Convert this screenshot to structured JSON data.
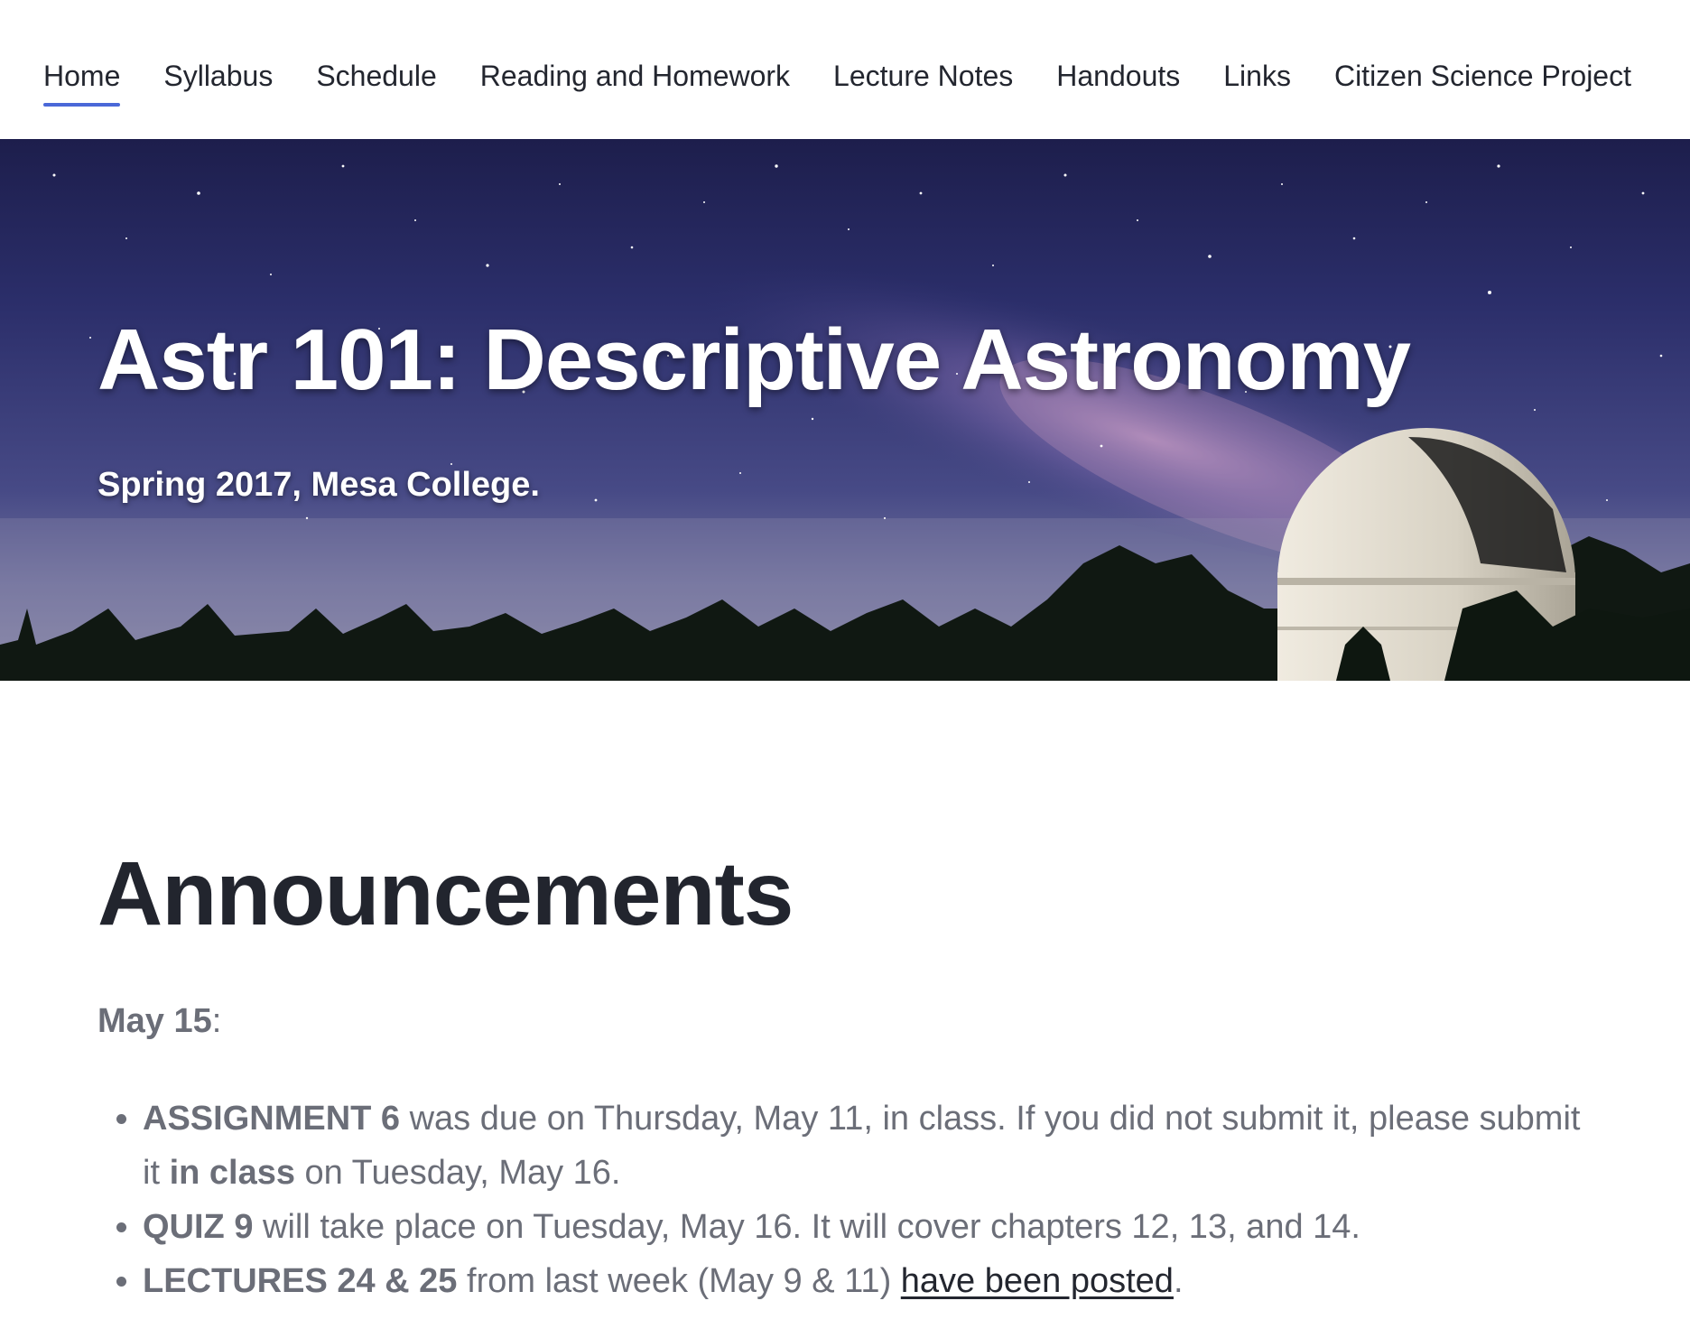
{
  "nav": {
    "items": [
      {
        "label": "Home",
        "active": true
      },
      {
        "label": "Syllabus",
        "active": false
      },
      {
        "label": "Schedule",
        "active": false
      },
      {
        "label": "Reading and Homework",
        "active": false
      },
      {
        "label": "Lecture Notes",
        "active": false
      },
      {
        "label": "Handouts",
        "active": false
      },
      {
        "label": "Links",
        "active": false
      },
      {
        "label": "Citizen Science Project",
        "active": false
      }
    ],
    "accent_color": "#4a68d8"
  },
  "hero": {
    "title": "Astr 101: Descriptive Astronomy",
    "subtitle": "Spring 2017, Mesa College."
  },
  "content": {
    "heading": "Announcements",
    "date_label": "May 15",
    "date_suffix": ":",
    "bullets": [
      {
        "bold": "ASSIGNMENT 6",
        "text1": " was due on Thursday, May 11, in class.  If you did not submit it, please submit it ",
        "bold2": "in class",
        "text2": " on Tuesday, May 16."
      },
      {
        "bold": "QUIZ 9",
        "text1": " will take place on Tuesday, May 16.  It will cover chapters 12, 13, and 14."
      },
      {
        "bold": "LECTURES 24 & 25",
        "text1": " from last week (May 9 & 11) ",
        "link": "have been posted",
        "text2": "."
      }
    ]
  }
}
